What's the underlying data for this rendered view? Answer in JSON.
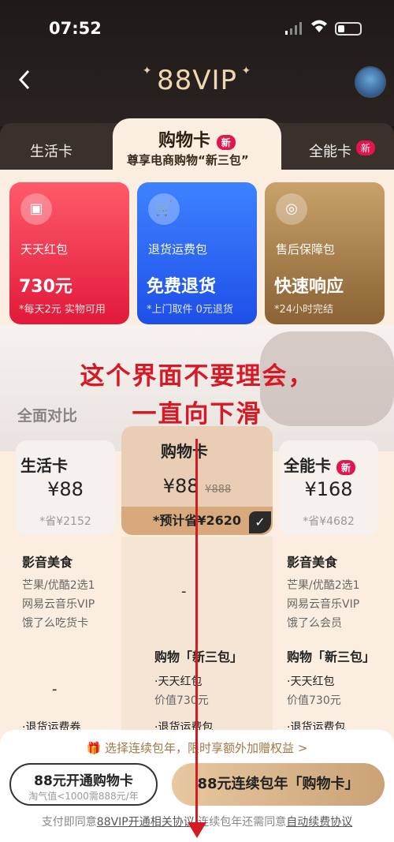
{
  "status": {
    "time": "07:52"
  },
  "header": {
    "title": "88VIP"
  },
  "tabs": {
    "left": "生活卡",
    "main": {
      "title": "购物卡",
      "badge": "新",
      "subtitle": "尊享电商购物“新三包”"
    },
    "right": {
      "title": "全能卡",
      "badge": "新"
    }
  },
  "cards": [
    {
      "label": "天天红包",
      "value": "730元",
      "sub": "*每天2元 实物可用"
    },
    {
      "label": "退货运费包",
      "value": "免费退货",
      "sub": "*上门取件 0元退货"
    },
    {
      "label": "售后保障包",
      "value": "快速响应",
      "sub": "*24小时完结"
    }
  ],
  "annotation": {
    "line1": "这个界面不要理会，",
    "line2": "一直向下滑"
  },
  "compare": {
    "title": "全面对比"
  },
  "plans": [
    {
      "name": "生活卡",
      "price": "¥88",
      "save": "*省¥2152"
    },
    {
      "name": "购物卡",
      "price": "¥88",
      "orig": "¥888",
      "save": "*预计省¥2620"
    },
    {
      "name": "全能卡",
      "badge": "新",
      "price": "¥168",
      "save": "*省¥4682"
    }
  ],
  "rows": {
    "life_head": "影音美食",
    "life_items": [
      "芒果/优酷2选1",
      "网易云音乐VIP",
      "饿了么吃货卡"
    ],
    "mid_dash": "-",
    "all_head": "影音美食",
    "all_items": [
      "芒果/优酷2选1",
      "网易云音乐VIP",
      "饿了么会员"
    ],
    "mid_head2": "购物「新三包」",
    "mid_r1": "·天天红包",
    "mid_r2": "价值730元",
    "all_head2": "购物「新三包」",
    "all_r1": "·天天红包",
    "all_r2": "价值730元",
    "life_dash": "-",
    "life_last": "·退货运费券",
    "mid_last": "·退货运费包",
    "all_last": "·退货运费包"
  },
  "bottom": {
    "promo": "选择连续包年，限时享额外加赠权益 >",
    "btn1_main": "88元开通购物卡",
    "btn1_sub": "淘气值<1000需888元/年",
    "btn2": "88元连续包年「购物卡」",
    "terms_pre": "支付即同意",
    "terms_link1": "88VIP开通相关协议",
    "terms_mid": "连续包年还需同意",
    "terms_link2": "自动续费协议"
  }
}
